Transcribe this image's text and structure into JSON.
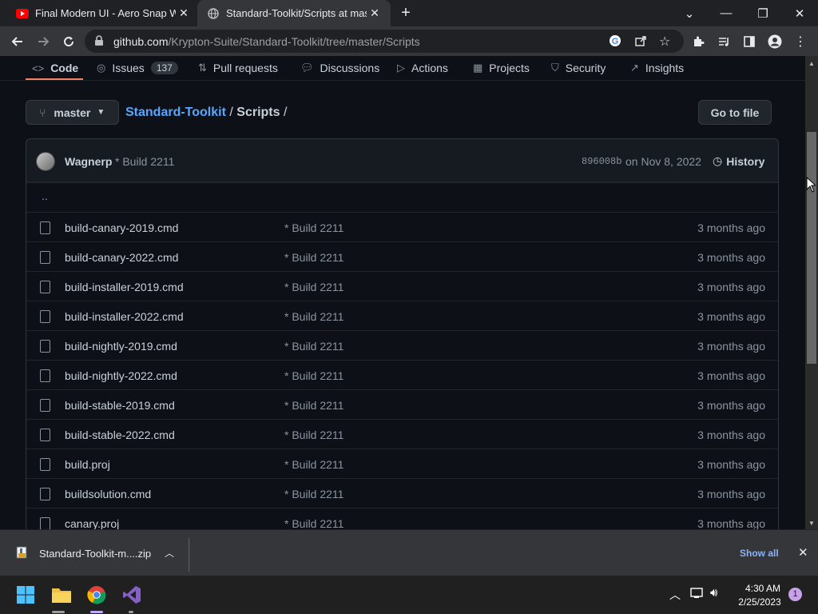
{
  "browser": {
    "tabs": [
      {
        "title": "Final Modern UI - Aero Snap Win",
        "active": false
      },
      {
        "title": "Standard-Toolkit/Scripts at maste",
        "active": true
      }
    ],
    "new_tab": "+",
    "address": {
      "host": "github.com",
      "path": "/Krypton-Suite/Standard-Toolkit/tree/master/Scripts"
    }
  },
  "repo_nav": {
    "items": [
      {
        "label": "Code",
        "icon": "code-icon"
      },
      {
        "label": "Issues",
        "icon": "issue-icon",
        "count": "137"
      },
      {
        "label": "Pull requests",
        "icon": "pr-icon"
      },
      {
        "label": "Discussions",
        "icon": "discussion-icon"
      },
      {
        "label": "Actions",
        "icon": "play-icon"
      },
      {
        "label": "Projects",
        "icon": "table-icon"
      },
      {
        "label": "Security",
        "icon": "shield-icon"
      },
      {
        "label": "Insights",
        "icon": "graph-icon"
      }
    ]
  },
  "branch": "master",
  "breadcrumb": {
    "repo": "Standard-Toolkit",
    "sep": "/",
    "folder": "Scripts",
    "trail": "/"
  },
  "goto_file": "Go to file",
  "commit": {
    "author": "Wagnerp",
    "message": "* Build 2211",
    "sha": "896008b",
    "date": "on Nov 8, 2022",
    "history": "History"
  },
  "parent_dir": "..",
  "files": [
    {
      "name": "build-canary-2019.cmd",
      "message": "* Build 2211",
      "age": "3 months ago"
    },
    {
      "name": "build-canary-2022.cmd",
      "message": "* Build 2211",
      "age": "3 months ago"
    },
    {
      "name": "build-installer-2019.cmd",
      "message": "* Build 2211",
      "age": "3 months ago"
    },
    {
      "name": "build-installer-2022.cmd",
      "message": "* Build 2211",
      "age": "3 months ago"
    },
    {
      "name": "build-nightly-2019.cmd",
      "message": "* Build 2211",
      "age": "3 months ago"
    },
    {
      "name": "build-nightly-2022.cmd",
      "message": "* Build 2211",
      "age": "3 months ago"
    },
    {
      "name": "build-stable-2019.cmd",
      "message": "* Build 2211",
      "age": "3 months ago"
    },
    {
      "name": "build-stable-2022.cmd",
      "message": "* Build 2211",
      "age": "3 months ago"
    },
    {
      "name": "build.proj",
      "message": "* Build 2211",
      "age": "3 months ago"
    },
    {
      "name": "buildsolution.cmd",
      "message": "* Build 2211",
      "age": "3 months ago"
    },
    {
      "name": "canary.proj",
      "message": "* Build 2211",
      "age": "3 months ago"
    }
  ],
  "download": {
    "filename": "Standard-Toolkit-m....zip",
    "show_all": "Show all"
  },
  "taskbar": {
    "time": "4:30 AM",
    "date": "2/25/2023",
    "notification_count": "1",
    "apps": [
      "windows-start-icon",
      "file-explorer-icon",
      "chrome-icon",
      "visual-studio-icon"
    ]
  },
  "colors": {
    "accent_link": "#58a6ff",
    "tab_underline": "#f78166",
    "page_bg": "#0d1117"
  }
}
